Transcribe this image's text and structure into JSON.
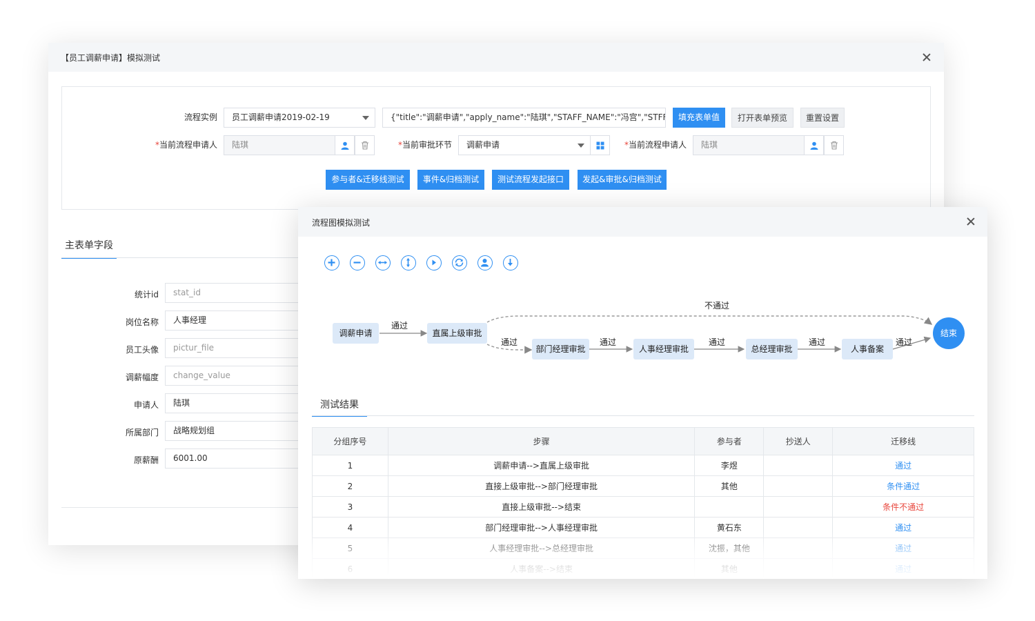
{
  "dialog_main": {
    "title": "【员工调薪申请】模拟测试",
    "labels": {
      "process_instance": "流程实例",
      "current_applicant": "当前流程申请人",
      "current_node": "当前审批环节",
      "current_applicant2": "当前流程申请人"
    },
    "required_mark": "*",
    "process_instance_value": "员工调薪申请2019-02-19",
    "json_value": "{\"title\":\"调薪申请\",\"apply_name\":\"陆琪\",\"STAFF_NAME\":\"冯宫\",\"STFF_I",
    "buttons": {
      "fill": "填充表单值",
      "preview": "打开表单预览",
      "reset": "重置设置",
      "participant_test": "参与者&迁移线测试",
      "event_test": "事件&归档测试",
      "start_api_test": "测试流程发起接口",
      "full_test": "发起&审批&归档测试"
    },
    "applicant_value": "陆琪",
    "node_value": "调薪申请",
    "applicant2_value": "陆琪",
    "tab_main_fields": "主表单字段",
    "fields": [
      {
        "label": "统计id",
        "value": "stat_id",
        "placeholder": true
      },
      {
        "label": "岗位名称",
        "value": "人事经理",
        "placeholder": false
      },
      {
        "label": "员工头像",
        "value": "pictur_file",
        "placeholder": true
      },
      {
        "label": "调薪幅度",
        "value": "change_value",
        "placeholder": true
      },
      {
        "label": "申请人",
        "value": "陆琪",
        "placeholder": false
      },
      {
        "label": "所属部门",
        "value": "战略规划组",
        "placeholder": false
      },
      {
        "label": "原薪酬",
        "value": "6001.00",
        "placeholder": false
      }
    ]
  },
  "dialog_flow": {
    "title": "流程图模拟测试",
    "toolbar_icons": [
      "zoom-in-icon",
      "zoom-out-icon",
      "fit-width-icon",
      "fit-height-icon",
      "play-icon",
      "refresh-icon",
      "user-icon",
      "download-icon"
    ],
    "flow": {
      "nodes": [
        "调薪申请",
        "直属上级审批",
        "部门经理审批",
        "人事经理审批",
        "总经理审批",
        "人事备案",
        "结束"
      ],
      "edge_labels": [
        "通过",
        "通过",
        "通过",
        "通过",
        "通过",
        "通过",
        "不通过"
      ]
    },
    "tab_results": "测试结果",
    "table": {
      "headers": [
        "分组序号",
        "步骤",
        "参与者",
        "抄送人",
        "迁移线"
      ],
      "rows": [
        [
          "1",
          "调薪申请-->直属上级审批",
          "李煜",
          "",
          "通过"
        ],
        [
          "2",
          "直接上级审批-->部门经理审批",
          "其他",
          "",
          "条件通过"
        ],
        [
          "3",
          "直接上级审批-->结束",
          "",
          "",
          "条件不通过"
        ],
        [
          "4",
          "部门经理审批-->人事经理审批",
          "黄石东",
          "",
          "通过"
        ],
        [
          "5",
          "人事经理审批-->总经理审批",
          "沈振，其他",
          "",
          "通过"
        ],
        [
          "6",
          "人事备案-->结束",
          "其他",
          "",
          "通过"
        ]
      ]
    }
  },
  "colors": {
    "accent": "#2f8ff2",
    "danger": "#e8463c",
    "node_fill": "#dce9f8"
  }
}
